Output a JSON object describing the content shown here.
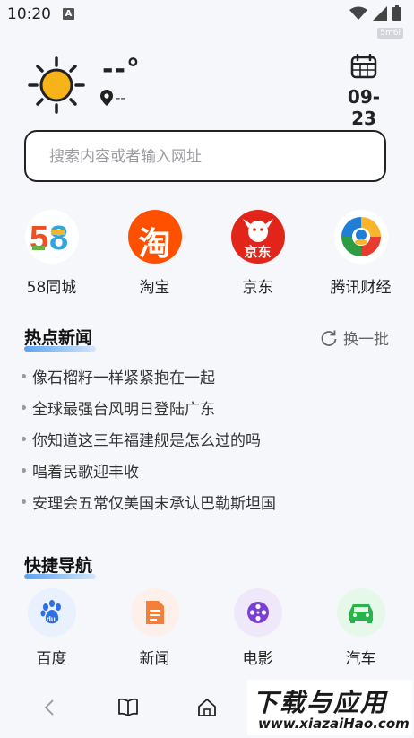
{
  "status_bar": {
    "time": "10:20",
    "notif_letter": "A",
    "badge": "5m6l"
  },
  "weather": {
    "temperature": "--°",
    "location": "--"
  },
  "date": {
    "text": "09-23"
  },
  "search": {
    "placeholder": "搜索内容或者输入网址"
  },
  "apps": [
    {
      "label": "58同城",
      "icon": "58-logo-icon"
    },
    {
      "label": "淘宝",
      "icon": "taobao-logo-icon",
      "glyph": "淘"
    },
    {
      "label": "京东",
      "icon": "jd-logo-icon",
      "glyph": "京东"
    },
    {
      "label": "腾讯财经",
      "icon": "tencent-finance-logo-icon"
    }
  ],
  "hot_news": {
    "title": "热点新闻",
    "refresh_label": "换一批",
    "items": [
      "像石榴籽一样紧紧抱在一起",
      "全球最强台风明日登陆广东",
      "你知道这三年福建舰是怎么过的吗",
      "唱着民歌迎丰收",
      "安理会五常仅美国未承认巴勒斯坦国"
    ]
  },
  "quick_nav": {
    "title": "快捷导航",
    "items": [
      {
        "label": "百度",
        "icon": "baidu-paw-icon",
        "bg": "#e8f1fd"
      },
      {
        "label": "新闻",
        "icon": "news-document-icon",
        "bg": "#fdf0ea"
      },
      {
        "label": "电影",
        "icon": "film-reel-icon",
        "bg": "#efe8fb"
      },
      {
        "label": "汽车",
        "icon": "car-icon",
        "bg": "#e6f8ea"
      }
    ]
  },
  "watermark": {
    "big": "下载与应用",
    "small": "www.xiazaiHao.com"
  }
}
